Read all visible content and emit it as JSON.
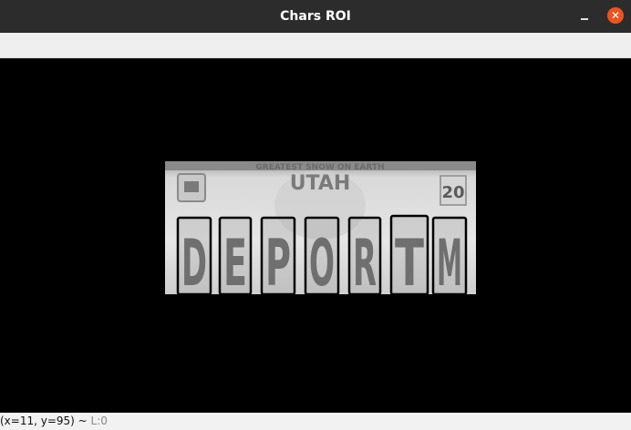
{
  "window": {
    "title": "Chars ROI",
    "minimize_icon": "minimize-icon",
    "close_icon": "close-icon",
    "close_glyph": "✕"
  },
  "image": {
    "description_colors": {
      "background": "#000000",
      "plate_light": "#dcdcdc",
      "char_box_stroke": "#000000"
    },
    "plate_header_text": "UTAH",
    "plate_top_text": "GREATEST SNOW ON EARTH",
    "plate_year": "20",
    "characters": [
      "D",
      "E",
      "P",
      "O",
      "R",
      "T",
      "M"
    ]
  },
  "status": {
    "coords": "(x=11, y=95) ~",
    "level": "L:0"
  }
}
